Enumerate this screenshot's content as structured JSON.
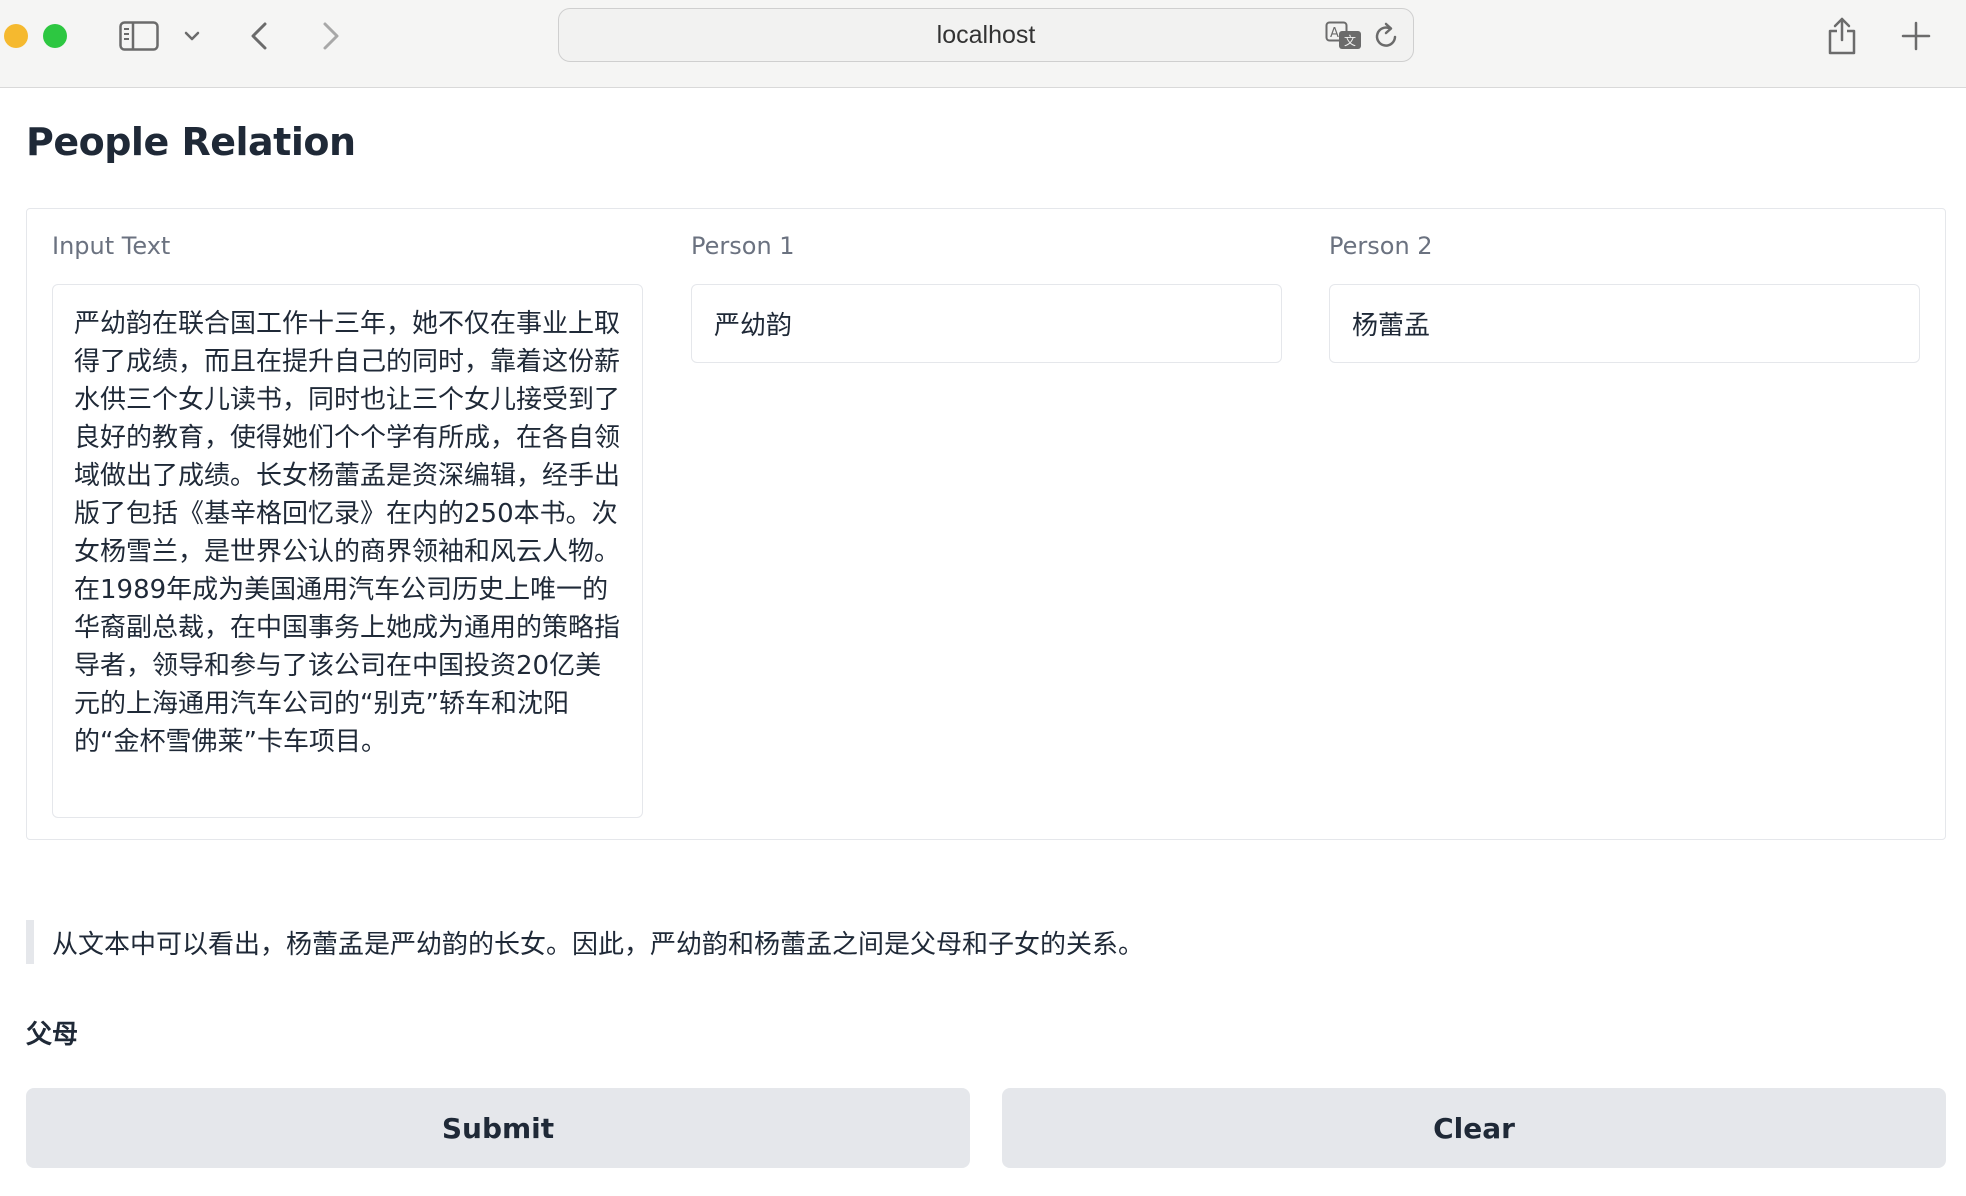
{
  "browser": {
    "url": "localhost",
    "icons": {
      "sidebar": "sidebar-icon",
      "sidebar_dropdown": "chevron-down-icon",
      "back": "chevron-left-icon",
      "forward": "chevron-right-icon",
      "translate": "translate-icon",
      "reload": "reload-icon",
      "share": "share-icon",
      "new_tab": "plus-icon"
    },
    "traffic_lights": [
      "#f5b92f",
      "#2dc741"
    ]
  },
  "page": {
    "title": "People Relation"
  },
  "inputs": {
    "input_text": {
      "label": "Input Text",
      "value": "严幼韵在联合国工作十三年，她不仅在事业上取得了成绩，而且在提升自己的同时，靠着这份薪水供三个女儿读书，同时也让三个女儿接受到了良好的教育，使得她们个个学有所成，在各自领域做出了成绩。长女杨蕾孟是资深编辑，经手出版了包括《基辛格回忆录》在内的250本书。次女杨雪兰，是世界公认的商界领袖和风云人物。在1989年成为美国通用汽车公司历史上唯一的华裔副总裁，在中国事务上她成为通用的策略指导者，领导和参与了该公司在中国投资20亿美元的上海通用汽车公司的“别克”轿车和沈阳的“金杯雪佛莱”卡车项目。"
    },
    "person1": {
      "label": "Person 1",
      "value": "严幼韵"
    },
    "person2": {
      "label": "Person 2",
      "value": "杨蕾孟"
    }
  },
  "output": {
    "explanation": "从文本中可以看出，杨蕾孟是严幼韵的长女。因此，严幼韵和杨蕾孟之间是父母和子女的关系。",
    "relation": "父母"
  },
  "buttons": {
    "submit": "Submit",
    "clear": "Clear"
  }
}
